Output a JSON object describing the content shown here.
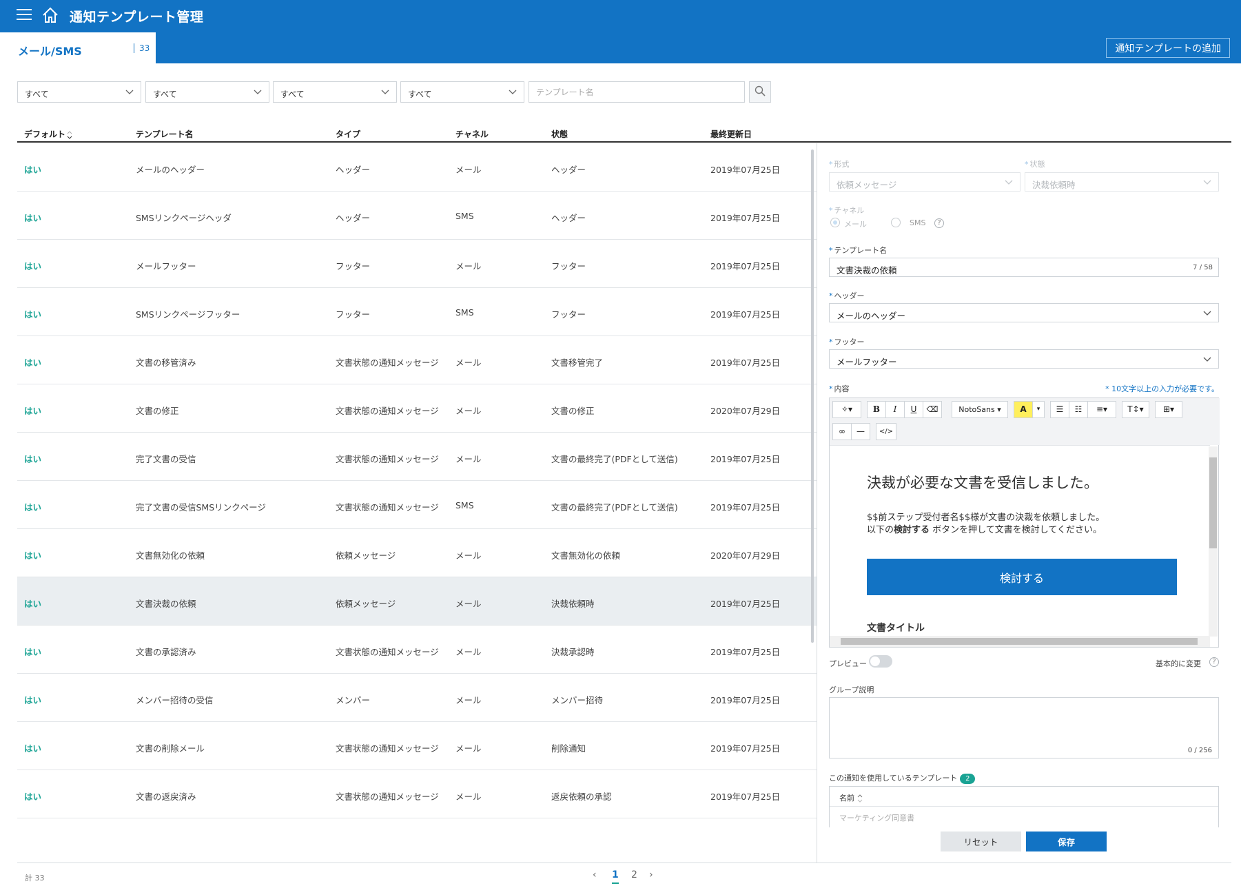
{
  "header": {
    "title": "通知テンプレート管理",
    "tab_label": "メール/SMS",
    "tab_count": "33",
    "add_button": "通知テンプレートの追加"
  },
  "filters": {
    "selects": [
      "すべて",
      "すべて",
      "すべて",
      "すべて"
    ],
    "search_placeholder": "テンプレート名"
  },
  "table": {
    "columns": [
      "デフォルト",
      "テンプレート名",
      "タイプ",
      "チャネル",
      "状態",
      "最終更新日"
    ],
    "rows": [
      {
        "default": "はい",
        "name": "メールのヘッダー",
        "type": "ヘッダー",
        "channel": "メール",
        "status": "ヘッダー",
        "date": "2019年07月25日"
      },
      {
        "default": "はい",
        "name": "SMSリンクページヘッダ",
        "type": "ヘッダー",
        "channel": "SMS",
        "status": "ヘッダー",
        "date": "2019年07月25日"
      },
      {
        "default": "はい",
        "name": "メールフッター",
        "type": "フッター",
        "channel": "メール",
        "status": "フッター",
        "date": "2019年07月25日"
      },
      {
        "default": "はい",
        "name": "SMSリンクページフッター",
        "type": "フッター",
        "channel": "SMS",
        "status": "フッター",
        "date": "2019年07月25日"
      },
      {
        "default": "はい",
        "name": "文書の移管済み",
        "type": "文書状態の通知メッセージ",
        "channel": "メール",
        "status": "文書移管完了",
        "date": "2019年07月25日"
      },
      {
        "default": "はい",
        "name": "文書の修正",
        "type": "文書状態の通知メッセージ",
        "channel": "メール",
        "status": "文書の修正",
        "date": "2020年07月29日"
      },
      {
        "default": "はい",
        "name": "完了文書の受信",
        "type": "文書状態の通知メッセージ",
        "channel": "メール",
        "status": "文書の最終完了(PDFとして送信)",
        "date": "2019年07月25日"
      },
      {
        "default": "はい",
        "name": "完了文書の受信SMSリンクページ",
        "type": "文書状態の通知メッセージ",
        "channel": "SMS",
        "status": "文書の最終完了(PDFとして送信)",
        "date": "2019年07月25日"
      },
      {
        "default": "はい",
        "name": "文書無効化の依頼",
        "type": "依頼メッセージ",
        "channel": "メール",
        "status": "文書無効化の依頼",
        "date": "2020年07月29日"
      },
      {
        "default": "はい",
        "name": "文書決裁の依頼",
        "type": "依頼メッセージ",
        "channel": "メール",
        "status": "決裁依頼時",
        "date": "2019年07月25日"
      },
      {
        "default": "はい",
        "name": "文書の承認済み",
        "type": "文書状態の通知メッセージ",
        "channel": "メール",
        "status": "決裁承認時",
        "date": "2019年07月25日"
      },
      {
        "default": "はい",
        "name": "メンバー招待の受信",
        "type": "メンバー",
        "channel": "メール",
        "status": "メンバー招待",
        "date": "2019年07月25日"
      },
      {
        "default": "はい",
        "name": "文書の削除メール",
        "type": "文書状態の通知メッセージ",
        "channel": "メール",
        "status": "削除通知",
        "date": "2019年07月25日"
      },
      {
        "default": "はい",
        "name": "文書の返戻済み",
        "type": "文書状態の通知メッセージ",
        "channel": "メール",
        "status": "返戻依頼の承認",
        "date": "2019年07月25日"
      }
    ],
    "selected_row": 9
  },
  "footer": {
    "total": "計 33",
    "pages": [
      "1",
      "2"
    ],
    "current_page": "1"
  },
  "form": {
    "format_label": "形式",
    "format_value": "依頼メッセージ",
    "status_label": "状態",
    "status_value": "決裁依頼時",
    "channel_label": "チャネル",
    "channel_options": [
      "メール",
      "SMS"
    ],
    "template_name_label": "テンプレート名",
    "template_name_value": "文書決裁の依頼",
    "template_name_counter": "7 / 58",
    "header_label": "ヘッダー",
    "header_value": "メールのヘッダー",
    "footer_label": "フッター",
    "footer_value": "メールフッター",
    "content_label": "内容",
    "content_hint": "* 10文字以上の入力が必要です。",
    "font_name": "NotoSans",
    "editor": {
      "heading": "決裁が必要な文書を受信しました。",
      "line1": "$$前ステップ受付者名$$様が文書の決裁を依頼しました。",
      "line2_pre": "以下の",
      "line2_bold": "検討する",
      "line2_post": " ボタンを押して文書を検討してください。",
      "button": "検討する",
      "subheading": "文書タイトル"
    },
    "preview_label": "プレビュー",
    "reset_default_label": "基本的に変更",
    "group_desc_label": "グループ説明",
    "group_desc_counter": "0 / 256",
    "used_templates_label": "この通知を使用しているテンプレート",
    "used_templates_count": "2",
    "used_templates_header": "名前",
    "used_templates_rows": [
      "マーケティング同意書"
    ],
    "reset_button": "リセット",
    "save_button": "保存"
  }
}
